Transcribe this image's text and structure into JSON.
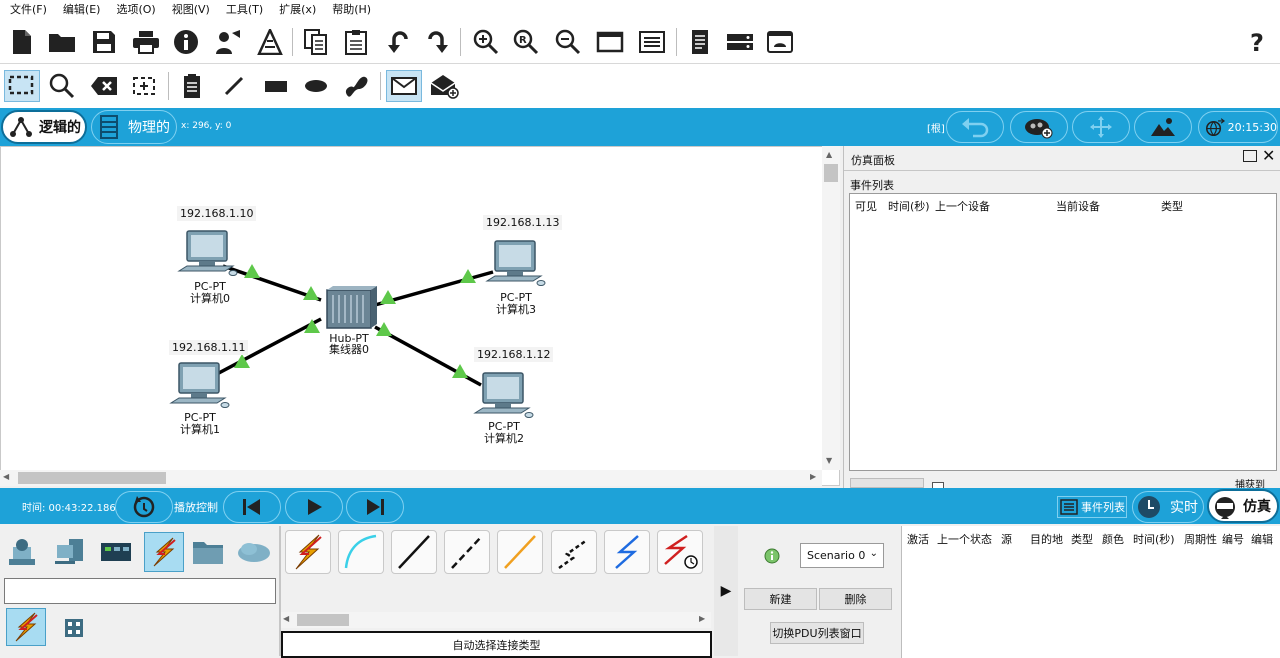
{
  "menu": [
    "文件(F)",
    "编辑(E)",
    "选项(O)",
    "视图(V)",
    "工具(T)",
    "扩展(x)",
    "帮助(H)"
  ],
  "mode_tabs": {
    "logical": "逻辑的",
    "physical": "物理的",
    "coords": "x: 296, y: 0"
  },
  "topbar": {
    "root_label": "[根]",
    "time": "20:15:30"
  },
  "devices": [
    {
      "ip": "192.168.1.10",
      "model": "PC-PT",
      "name": "计算机0"
    },
    {
      "ip": "192.168.1.11",
      "model": "PC-PT",
      "name": "计算机1"
    },
    {
      "ip": "192.168.1.12",
      "model": "PC-PT",
      "name": "计算机2"
    },
    {
      "ip": "192.168.1.13",
      "model": "PC-PT",
      "name": "计算机3"
    }
  ],
  "hub": {
    "model": "Hub-PT",
    "name": "集线器0"
  },
  "sim_panel": {
    "title": "仿真面板",
    "event_list_label": "事件列表",
    "columns": [
      "可见",
      "时间(秒)",
      "上一个设备",
      "当前设备",
      "类型"
    ],
    "capture_label": "捕获到"
  },
  "lowerbar": {
    "time_label": "时间: 00:43:22.186",
    "playback_label": "播放控制",
    "event_list_btn": "事件列表",
    "realtime": "实时",
    "simulation": "仿真"
  },
  "bottom": {
    "connection_type": "自动选择连接类型",
    "scenario": "Scenario 0",
    "new_btn": "新建",
    "delete_btn": "删除",
    "toggle_pdu_btn": "切换PDU列表窗口",
    "pdu_columns": [
      "激活",
      "上一个状态",
      "源",
      "目的地",
      "类型",
      "颜色",
      "时间(秒)",
      "周期性",
      "编号",
      "编辑"
    ]
  },
  "colors": {
    "accent": "#1ea2d8",
    "link": "#000000",
    "link_up": "#5ec84a",
    "lightning": "#e8a000"
  }
}
